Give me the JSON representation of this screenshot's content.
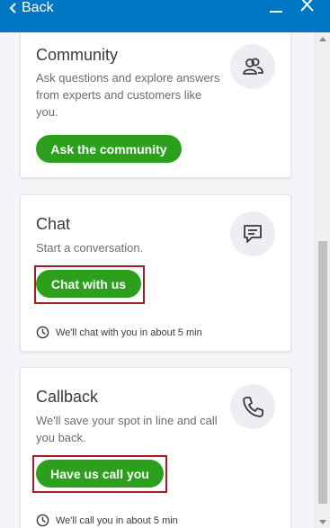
{
  "header": {
    "back_label": "Back",
    "minimize_icon": "minimize-icon",
    "close_icon": "close-icon",
    "background": "#0077c5"
  },
  "cards": {
    "community": {
      "title": "Community",
      "description": "Ask questions and explore answers from experts and customers like you.",
      "button_label": "Ask the community",
      "icon": "people-icon"
    },
    "chat": {
      "title": "Chat",
      "description": "Start a conversation.",
      "button_label": "Chat with us",
      "wait_text": "We'll chat with you in about 5 min",
      "icon": "chat-bubble-icon"
    },
    "callback": {
      "title": "Callback",
      "description": "We'll save your spot in line and call you back.",
      "button_label": "Have us call you",
      "wait_text": "We'll call you in about 5 min",
      "icon": "phone-icon"
    }
  },
  "colors": {
    "primary_button": "#2ca01c",
    "highlight_border": "#a31d22"
  }
}
